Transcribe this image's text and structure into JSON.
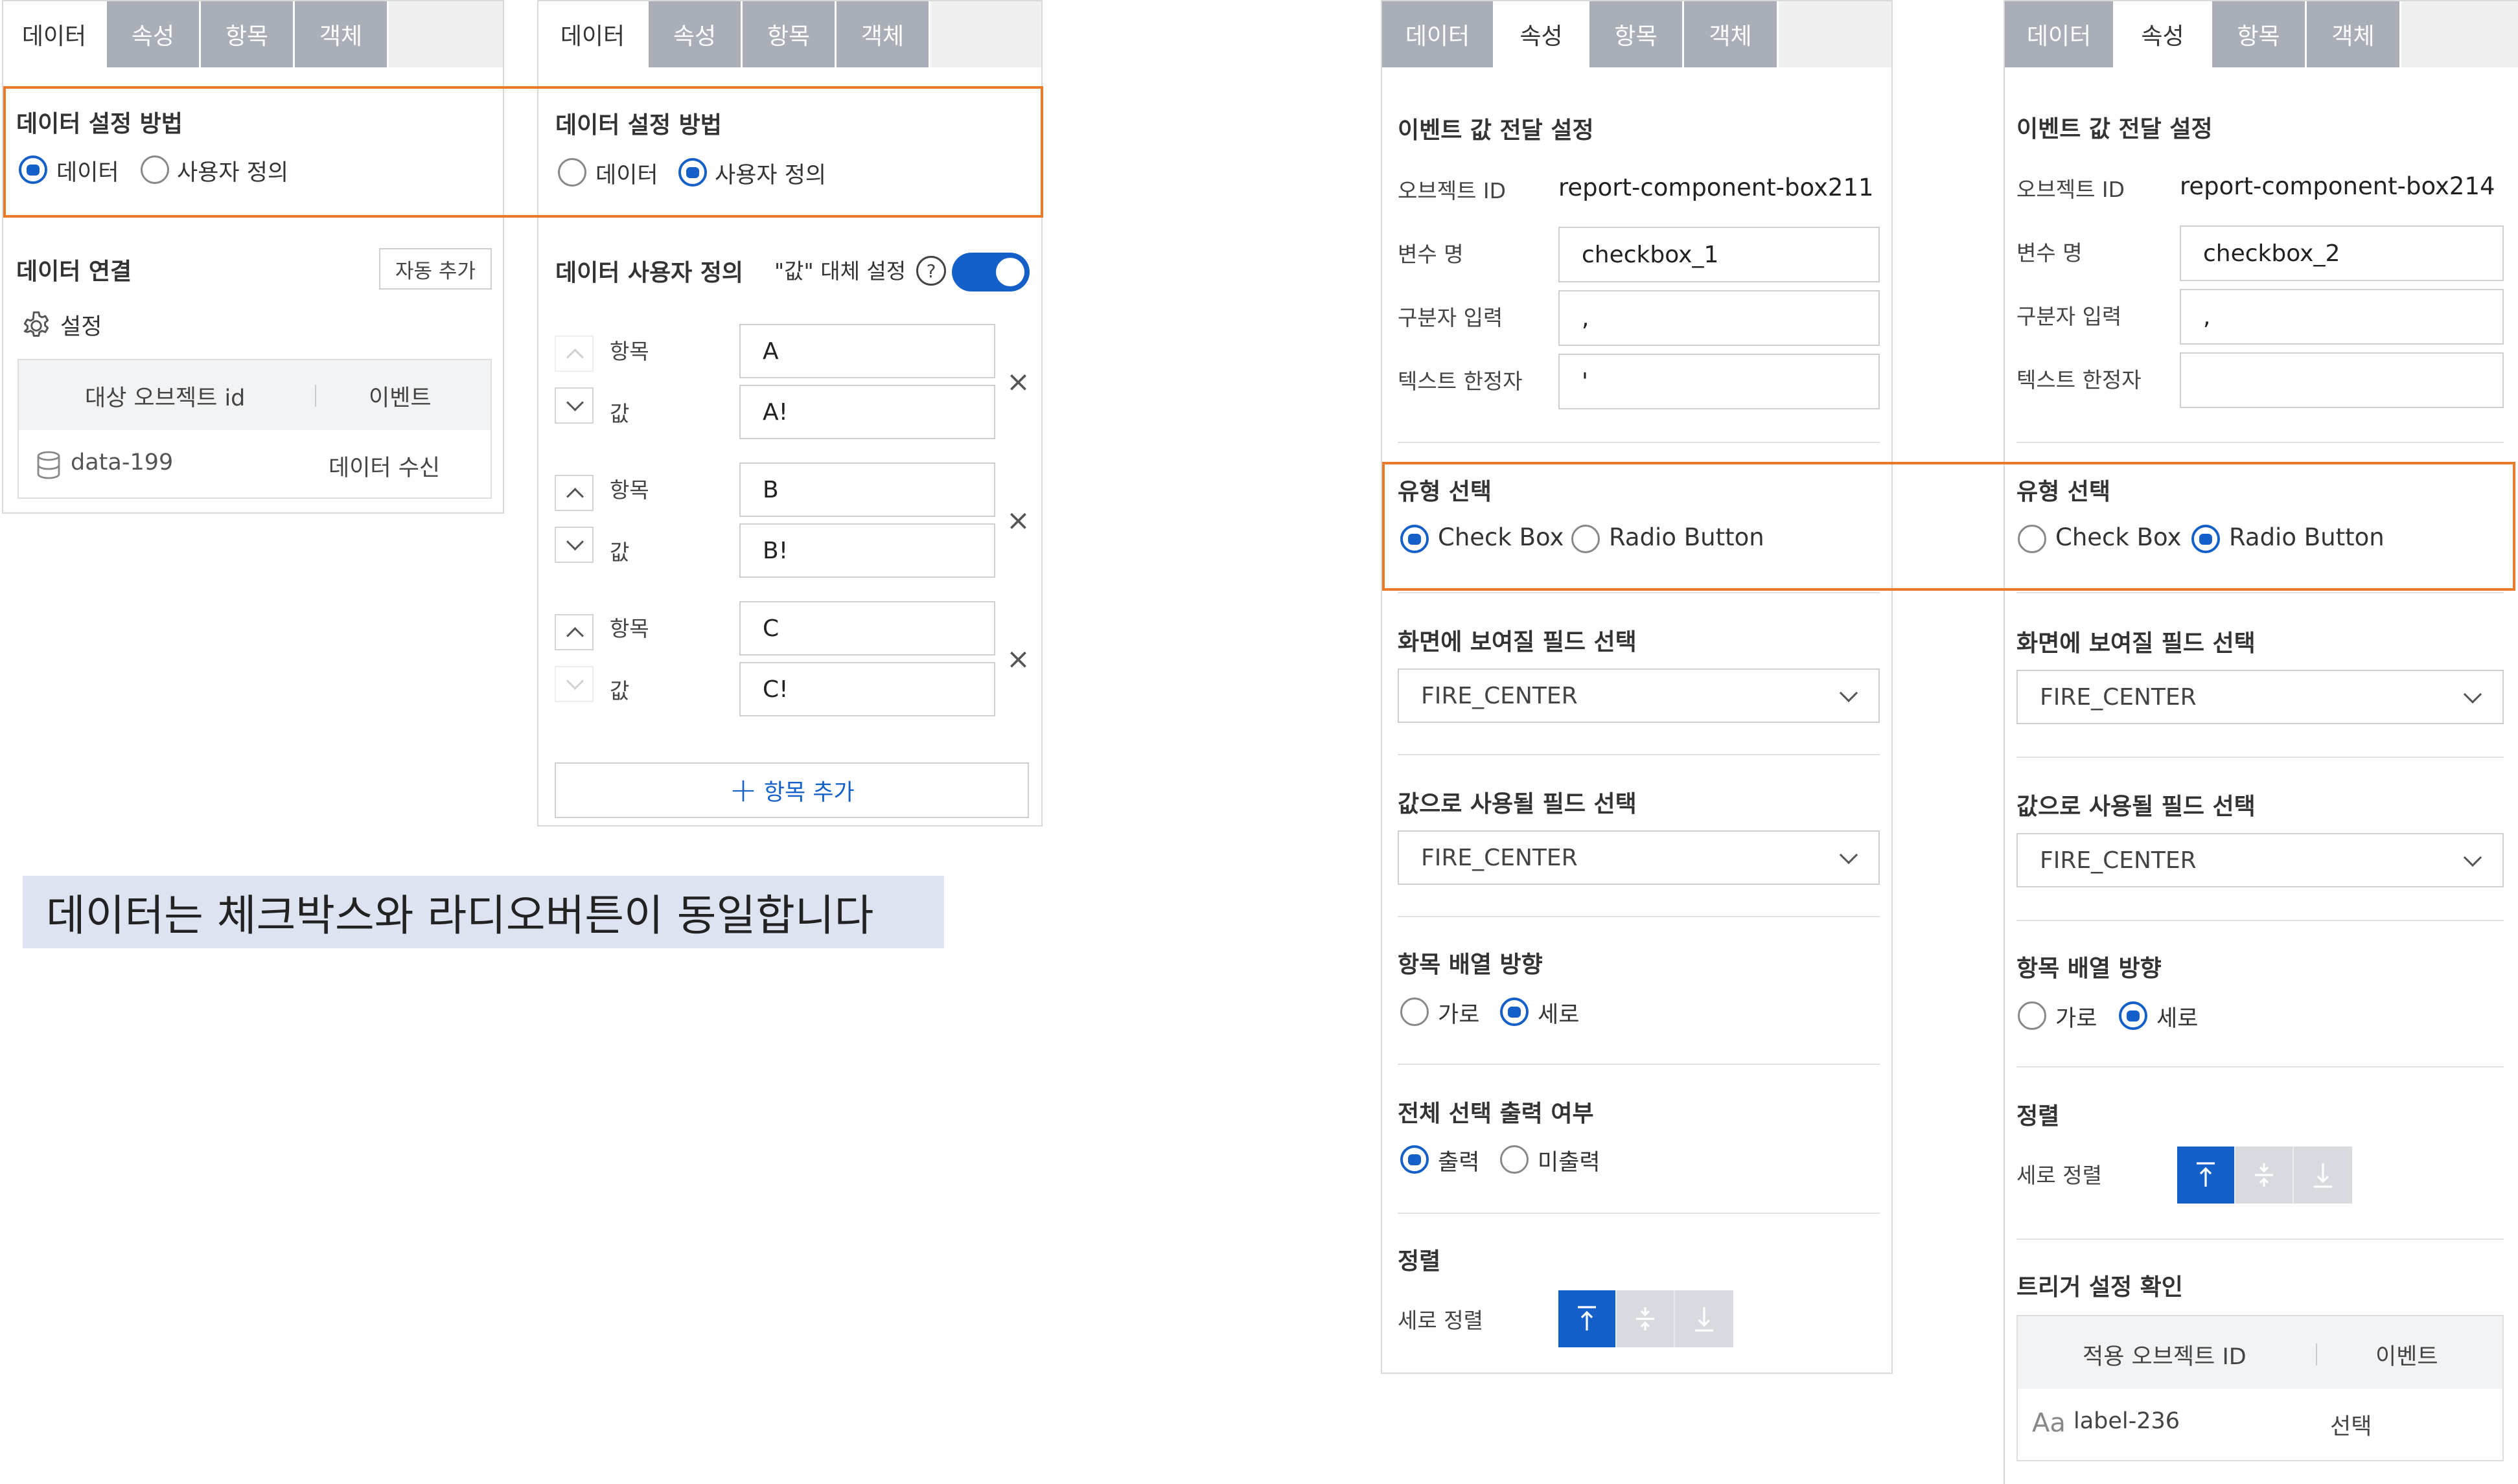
{
  "tabs": [
    "데이터",
    "속성",
    "항목",
    "객체"
  ],
  "panel1": {
    "section_title": "데이터 설정 방법",
    "radio_options": [
      "데이터",
      "사용자 정의"
    ],
    "selected": "데이터",
    "link_title": "데이터 연결",
    "auto_add_label": "자동 추가",
    "settings_label": "설정",
    "table_headers": [
      "대상 오브젝트 id",
      "이벤트"
    ],
    "row": {
      "id": "data-199",
      "event": "데이터 수신"
    }
  },
  "panel2": {
    "section_title": "데이터 설정 방법",
    "radio_options": [
      "데이터",
      "사용자 정의"
    ],
    "selected": "사용자 정의",
    "custom_title": "데이터 사용자 정의",
    "replace_label": "\"값\" 대체 설정",
    "help_symbol": "?",
    "item_label": "항목",
    "value_label": "값",
    "items": [
      {
        "item": "A",
        "value": "A!"
      },
      {
        "item": "B",
        "value": "B!"
      },
      {
        "item": "C",
        "value": "C!"
      }
    ],
    "add_label": "항목 추가"
  },
  "caption": "데이터는 체크박스와 라디오버튼이 동일합니다",
  "props": [
    {
      "event_title": "이벤트 값 전달 설정",
      "object_id_label": "오브젝트 ID",
      "object_id": "report-component-box211",
      "var_label": "변수 명",
      "var_value": "checkbox_1",
      "sep_label": "구분자 입력",
      "sep_value": ",",
      "quote_label": "텍스트 한정자",
      "quote_value": "'",
      "type_title": "유형 선택",
      "type_options": [
        "Check Box",
        "Radio Button"
      ],
      "type_selected": "Check Box",
      "display_title": "화면에 보여질 필드 선택",
      "display_value": "FIRE_CENTER",
      "value_title": "값으로 사용될 필드 선택",
      "value_value": "FIRE_CENTER",
      "dir_title": "항목 배열 방향",
      "dir_options": [
        "가로",
        "세로"
      ],
      "dir_selected": "세로",
      "all_title": "전체 선택 출력 여부",
      "all_options": [
        "출력",
        "미출력"
      ],
      "all_selected": "출력",
      "align_title": "정렬",
      "valign_label": "세로 정렬"
    },
    {
      "event_title": "이벤트 값 전달 설정",
      "object_id_label": "오브젝트 ID",
      "object_id": "report-component-box214",
      "var_label": "변수 명",
      "var_value": "checkbox_2",
      "sep_label": "구분자 입력",
      "sep_value": ",",
      "quote_label": "텍스트 한정자",
      "quote_value": "",
      "type_title": "유형 선택",
      "type_options": [
        "Check Box",
        "Radio Button"
      ],
      "type_selected": "Radio Button",
      "display_title": "화면에 보여질 필드 선택",
      "display_value": "FIRE_CENTER",
      "value_title": "값으로 사용될 필드 선택",
      "value_value": "FIRE_CENTER",
      "dir_title": "항목 배열 방향",
      "dir_options": [
        "가로",
        "세로"
      ],
      "dir_selected": "세로",
      "align_title": "정렬",
      "valign_label": "세로 정렬",
      "trigger_title": "트리거 설정 확인",
      "trigger_headers": [
        "적용 오브젝트 ID",
        "이벤트"
      ],
      "trigger_row": {
        "icon": "Aa",
        "id": "label-236",
        "event": "선택"
      }
    }
  ],
  "colors": {
    "accent": "#1560c8",
    "highlight": "#e87a2a",
    "tab_inactive": "#a9aeb7",
    "caption_bg": "#dde3f0"
  }
}
